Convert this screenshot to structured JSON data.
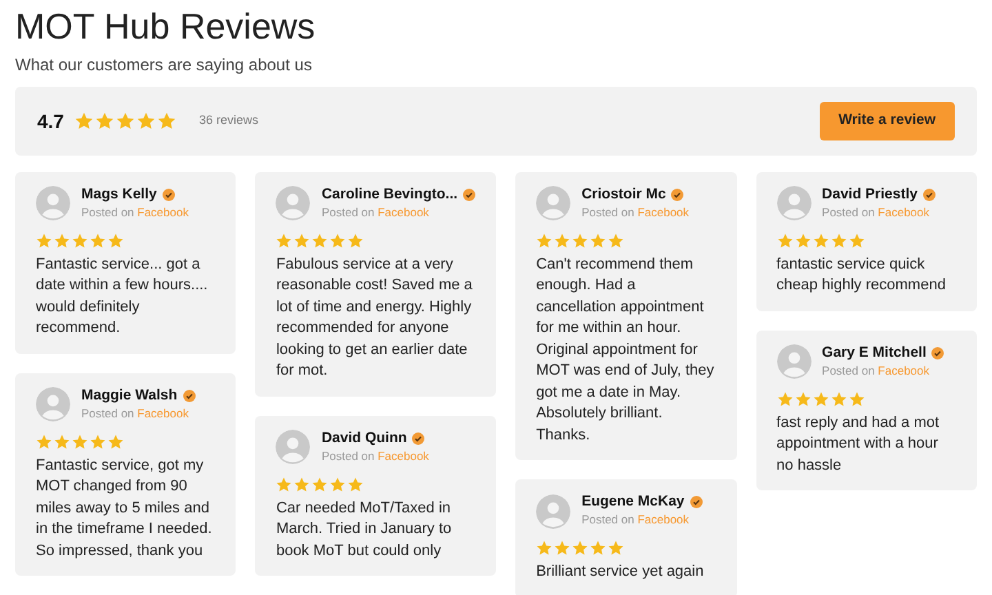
{
  "title": "MOT Hub Reviews",
  "subtitle": "What our customers are saying about us",
  "summary": {
    "rating": "4.7",
    "stars": 5,
    "count": "36 reviews",
    "button": "Write a review"
  },
  "review_columns": [
    {
      "reviews": [
        {
          "name": "Mags Kelly",
          "posted_prefix": "Posted on",
          "source": "Facebook",
          "stars": 5,
          "text": "Fantastic service... got a date within a few hours.... would definitely recommend."
        },
        {
          "name": "Maggie Walsh",
          "posted_prefix": "Posted on",
          "source": "Facebook",
          "stars": 5,
          "text": "Fantastic service, got my MOT changed from 90 miles away to 5 miles and in the timeframe I needed. So impressed, thank you"
        }
      ]
    },
    {
      "reviews": [
        {
          "name": "Caroline Bevingto...",
          "posted_prefix": "Posted on",
          "source": "Facebook",
          "stars": 5,
          "text": "Fabulous service at a very reasonable cost! Saved me a lot of time and energy. Highly recommended for anyone looking to get an earlier date for mot."
        },
        {
          "name": "David Quinn",
          "posted_prefix": "Posted on",
          "source": "Facebook",
          "stars": 5,
          "text": "Car needed MoT/Taxed in March. Tried in January to book MoT but could only"
        }
      ]
    },
    {
      "reviews": [
        {
          "name": "Criostoir Mc",
          "posted_prefix": "Posted on",
          "source": "Facebook",
          "stars": 5,
          "text": "Can't recommend them enough. Had a cancellation appointment for me within an hour. Original appointment for MOT was end of July, they got me a date in May. Absolutely brilliant. Thanks."
        },
        {
          "name": "Eugene McKay",
          "posted_prefix": "Posted on",
          "source": "Facebook",
          "stars": 5,
          "text": "Brilliant service yet again"
        }
      ]
    },
    {
      "reviews": [
        {
          "name": "David Priestly",
          "posted_prefix": "Posted on",
          "source": "Facebook",
          "stars": 5,
          "text": "fantastic service quick cheap highly recommend"
        },
        {
          "name": "Gary E Mitchell",
          "posted_prefix": "Posted on",
          "source": "Facebook",
          "stars": 5,
          "text": "fast reply and had a mot appointment with a hour no hassle"
        }
      ]
    }
  ]
}
